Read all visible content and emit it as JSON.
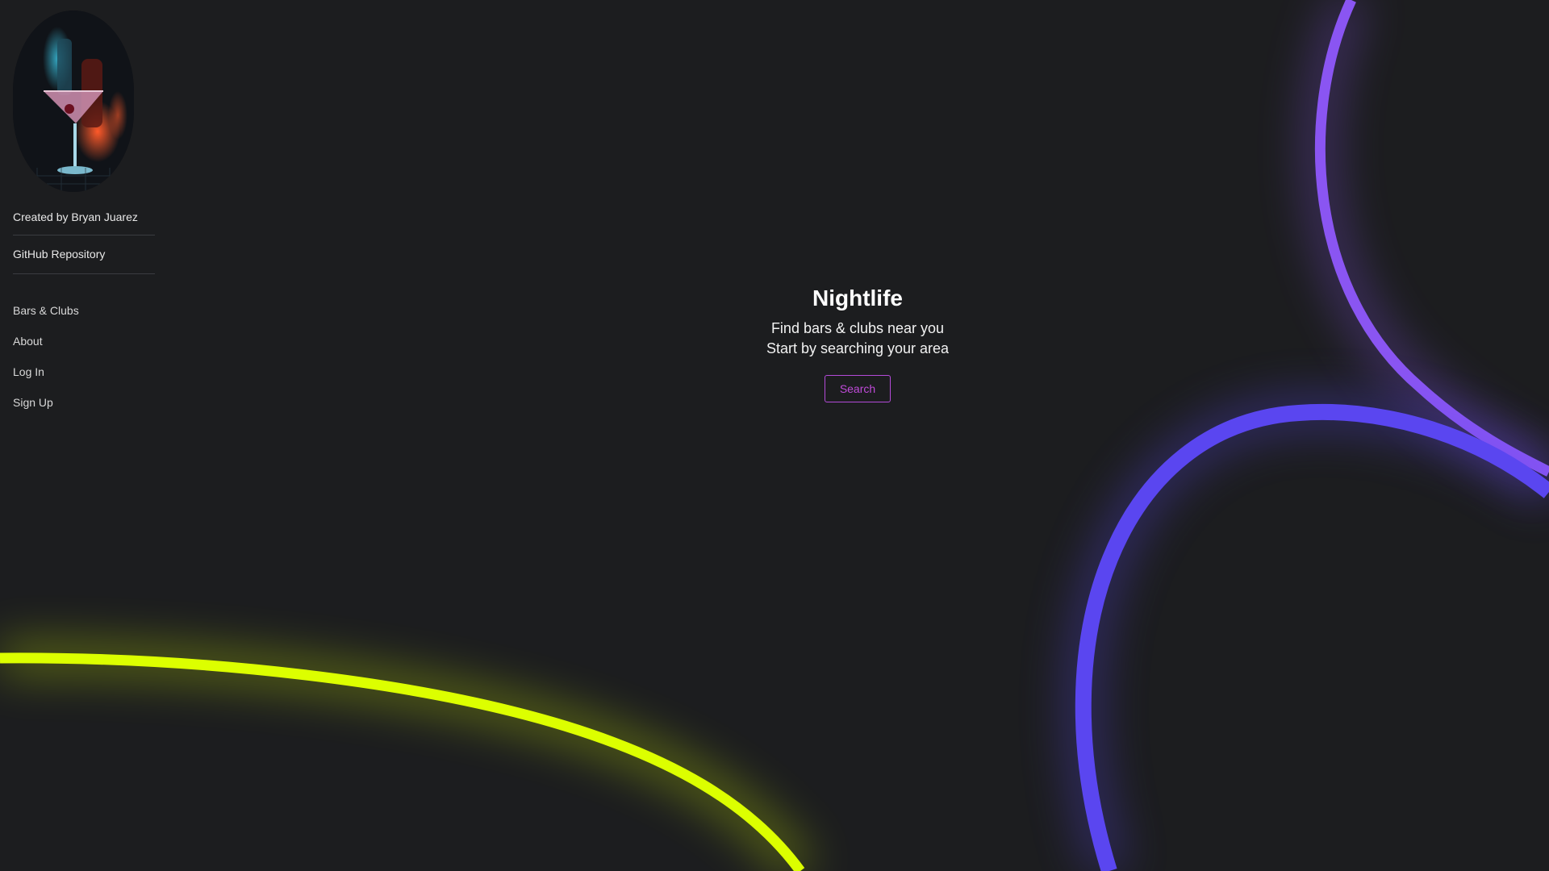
{
  "sidebar": {
    "credit_label": "Created by Bryan Juarez",
    "repo_label": "GitHub Repository",
    "nav": [
      {
        "label": "Bars & Clubs"
      },
      {
        "label": "About"
      },
      {
        "label": "Log In"
      },
      {
        "label": "Sign Up"
      }
    ]
  },
  "hero": {
    "title": "Nightlife",
    "subtitle_line1": "Find bars & clubs near you",
    "subtitle_line2": "Start by searching your area",
    "search_label": "Search"
  },
  "colors": {
    "background": "#1c1d1f",
    "neon_purple": "#8a55f2",
    "neon_blue": "#5a46f0",
    "neon_yellow": "#dcff00",
    "button_accent": "#c04bd9"
  },
  "icons": {
    "avatar": "cocktail-glass-photo"
  }
}
